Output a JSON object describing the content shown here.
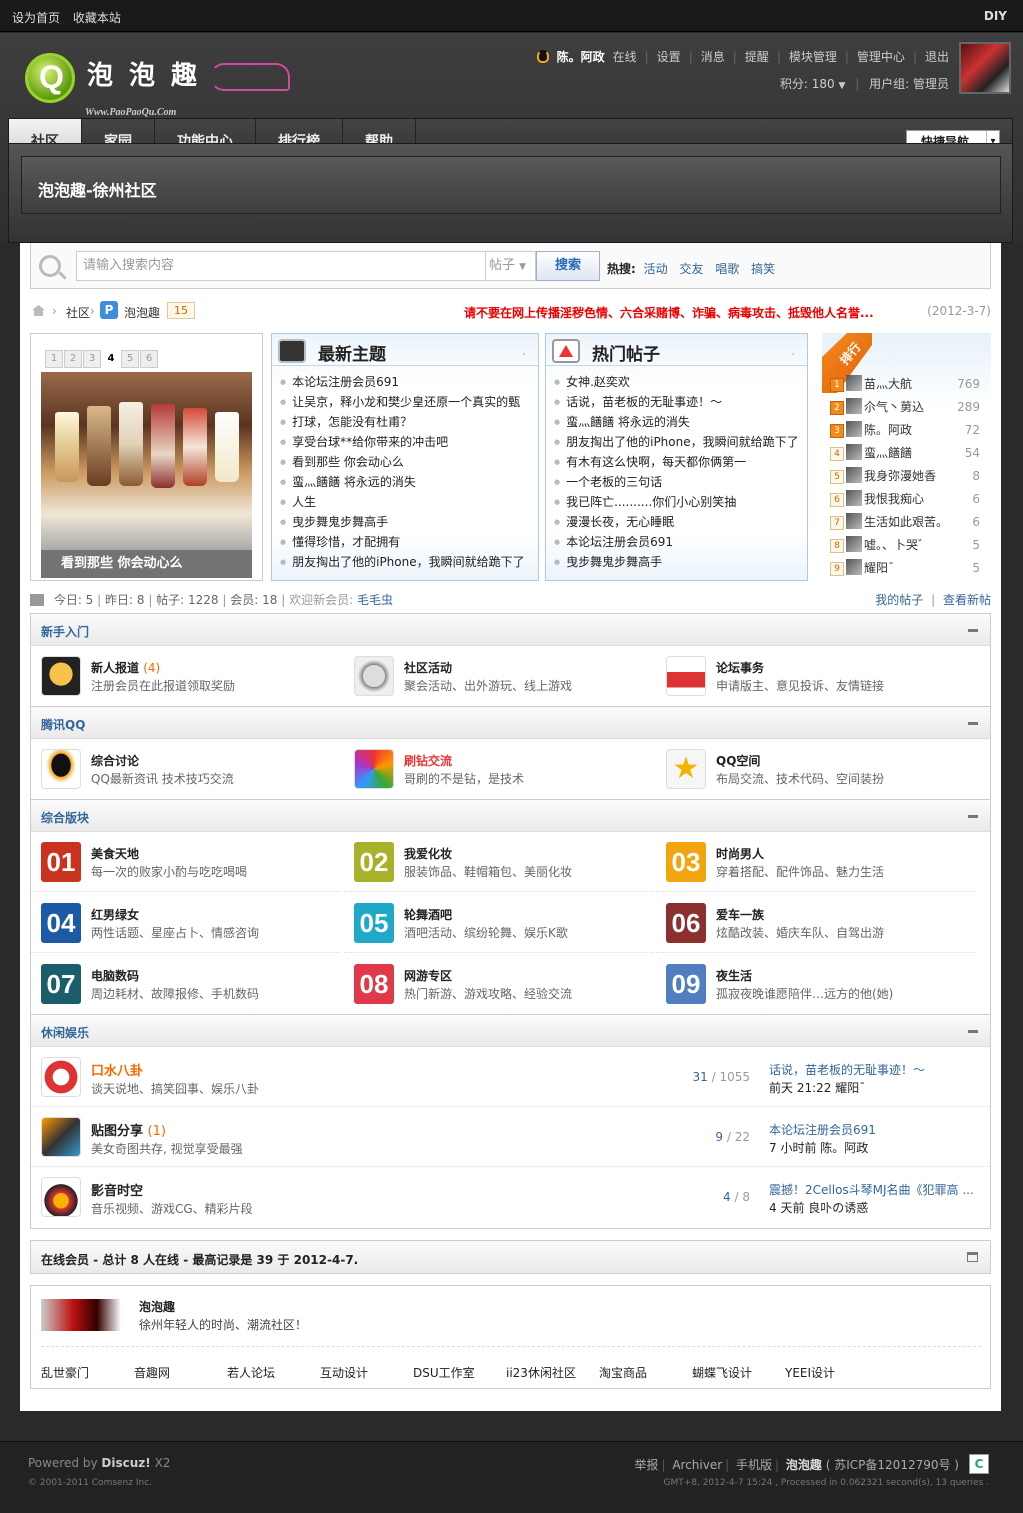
{
  "topbar": {
    "set_home": "设为首页",
    "bookmark": "收藏本站",
    "diy": "DIY"
  },
  "logo": {
    "text": "泡泡趣",
    "url": "Www.PaoPaoQu.Com"
  },
  "user": {
    "name": "陈。阿政",
    "status": "在线",
    "links": [
      "设置",
      "消息",
      "提醒",
      "模块管理",
      "管理中心",
      "退出"
    ],
    "points": "积分: 180",
    "group": "用户组: 管理员"
  },
  "nav": {
    "items": [
      "社区",
      "家园",
      "功能中心",
      "排行榜",
      "帮助"
    ],
    "quick": "快捷导航"
  },
  "page_title": "泡泡趣-徐州社区",
  "search": {
    "placeholder": "请输入搜索内容",
    "type": "帖子",
    "button": "搜索",
    "hot_label": "热搜:",
    "hot": [
      "活动",
      "交友",
      "唱歌",
      "搞笑"
    ]
  },
  "crumb": {
    "community": "社区",
    "forum": "泡泡趣",
    "count": "15",
    "warning": "请不要在网上传播淫秽色情、六合采赌博、诈骗、病毒攻击、抵毁他人名誉...",
    "date": "(2012-3-7)"
  },
  "slide": {
    "pages": [
      "1",
      "2",
      "3",
      "4",
      "5",
      "6"
    ],
    "caption": "看到那些 你会动心么"
  },
  "newest": {
    "title": "最新主题",
    "items": [
      "本论坛注册会员691",
      "让吴京，释小龙和樊少皇还原一个真实的甄",
      "打球，怎能没有杜甫？",
      "享受台球**给你带来的冲击吧",
      "看到那些 你会动心么",
      "蛮灬饍饍 将永远的消失",
      "人生",
      "曳步舞鬼步舞高手",
      "懂得珍惜，才配拥有",
      "朋友掏出了他的iPhone，我瞬间就给跪下了"
    ]
  },
  "hot_posts": {
    "title": "热门帖子",
    "items": [
      "女神.赵奕欢",
      "话说，苗老板的无耻事迹！～",
      "蛮灬饍饍 将永远的消失",
      "朋友掏出了他的iPhone，我瞬间就给跪下了",
      "有木有这么快啊，每天都你俩第一",
      "一个老板的三句话",
      "我已阵亡..........你们小心别笑抽",
      "漫漫长夜，无心睡眠",
      "本论坛注册会员691",
      "曳步舞鬼步舞高手"
    ]
  },
  "rank": {
    "ribbon": "排行",
    "items": [
      {
        "n": "1",
        "name": "苗灬大航",
        "v": "769"
      },
      {
        "n": "2",
        "name": "尒气丶莮込",
        "v": "289"
      },
      {
        "n": "3",
        "name": "陈。阿政",
        "v": "72"
      },
      {
        "n": "4",
        "name": "蛮灬饍饍",
        "v": "54"
      },
      {
        "n": "5",
        "name": "我身弥漫她香",
        "v": "8"
      },
      {
        "n": "6",
        "name": "我恨我痴心",
        "v": "6"
      },
      {
        "n": "7",
        "name": "生活如此艰苦。",
        "v": "6"
      },
      {
        "n": "8",
        "name": "嘘。、卜哭゛",
        "v": "5"
      },
      {
        "n": "9",
        "name": "耀阳ˉ",
        "v": "5"
      }
    ]
  },
  "stats": {
    "today": "今日: 5",
    "yesterday": "昨日: 8",
    "posts": "帖子: 1228",
    "members": "会员: 18",
    "welcome": "欢迎新会员:",
    "newuser": "毛毛虫",
    "my_posts": "我的帖子",
    "new_posts": "查看新帖"
  },
  "sections": {
    "newbie": {
      "title": "新手入门",
      "items": [
        {
          "name": "新人报道",
          "count": "(4)",
          "desc": "注册会员在此报道领取奖励"
        },
        {
          "name": "社区活动",
          "count": "",
          "desc": "聚会活动、出外游玩、线上游戏"
        },
        {
          "name": "论坛事务",
          "count": "",
          "desc": "申请版主、意见投诉、友情链接"
        }
      ]
    },
    "qq": {
      "title": "腾讯QQ",
      "items": [
        {
          "name": "综合讨论",
          "count": "",
          "desc": "QQ最新资讯 技术技巧交流"
        },
        {
          "name": "刷钻交流",
          "count": "",
          "desc": "哥刷的不是钻，是技术"
        },
        {
          "name": "QQ空间",
          "count": "",
          "desc": "布局交流、技术代码、空间装扮"
        }
      ]
    },
    "general": {
      "title": "综合版块",
      "items": [
        {
          "num": "01",
          "color": "#c9331e",
          "name": "美食天地",
          "desc": "每一次的败家小酌与吃吃喝喝"
        },
        {
          "num": "02",
          "color": "#a8b12a",
          "name": "我爱化妆",
          "desc": "服装饰品、鞋帽箱包、美丽化妆"
        },
        {
          "num": "03",
          "color": "#f3a50f",
          "name": "时尚男人",
          "desc": "穿着搭配、配件饰品、魅力生活"
        },
        {
          "num": "04",
          "color": "#1c5aa6",
          "name": "红男绿女",
          "desc": "两性话题、星座占卜、情感咨询"
        },
        {
          "num": "05",
          "color": "#1fa8c8",
          "name": "轮舞酒吧",
          "desc": "酒吧活动、缤纷轮舞、娱乐K歌"
        },
        {
          "num": "06",
          "color": "#8b2f2f",
          "name": "爱车一族",
          "desc": "炫酷改装、婚庆车队、自驾出游"
        },
        {
          "num": "07",
          "color": "#1b5d6b",
          "name": "电脑数码",
          "desc": "周边耗材、故障报修、手机数码"
        },
        {
          "num": "08",
          "color": "#e03a4a",
          "name": "网游专区",
          "desc": "热门新游、游戏攻略、经验交流"
        },
        {
          "num": "09",
          "color": "#4f7fbf",
          "name": "夜生活",
          "desc": "孤寂夜晚谁愿陪伴…远方的他(她)"
        }
      ]
    },
    "leisure": {
      "title": "休闲娱乐",
      "items": [
        {
          "name": "口水八卦",
          "count": "",
          "desc": "谈天说地、搞笑囧事、娱乐八卦",
          "threads": "31",
          "posts": "1055",
          "last": "话说，苗老板的无耻事迹！～",
          "by": "前天 21:22 耀阳ˉ"
        },
        {
          "name": "贴图分享",
          "count": "(1)",
          "desc": "美女奇图共存, 视觉享受最强",
          "threads": "9",
          "posts": "22",
          "last": "本论坛注册会员691",
          "by": "7 小时前 陈。阿政"
        },
        {
          "name": "影音时空",
          "count": "",
          "desc": "音乐视频、游戏CG、精彩片段",
          "threads": "4",
          "posts": "8",
          "last": "震撼！2Cellos斗琴MJ名曲《犯罪高 ...",
          "by": "4 天前 良卟の诱惑"
        }
      ]
    }
  },
  "online": "在线会员 - 总计 8 人在线 - 最高记录是 39 于 2012-4-7.",
  "links": {
    "name": "泡泡趣",
    "desc": "徐州年轻人的时尚、潮流社区！",
    "items": [
      "乱世豪门",
      "音趣网",
      "若人论坛",
      "互动设计",
      "DSU工作室",
      "ii23休闲社区",
      "淘宝商品",
      "蝴蝶飞设计",
      "YEEI设计"
    ]
  },
  "footer": {
    "powered": "Powered by",
    "brand": "Discuz!",
    "ver": "X2",
    "copyright": "© 2001-2011 Comsenz Inc.",
    "links": [
      "举报",
      "Archiver",
      "手机版"
    ],
    "site": "泡泡趣",
    "icp": "( 苏ICP备12012790号 )",
    "gmt": "GMT+8, 2012-4-7 15:24 , Processed in 0.062321 second(s), 13 queries ."
  },
  "colors": {
    "link": "#336699",
    "accent": "#f06000",
    "warning": "#ee0000"
  }
}
